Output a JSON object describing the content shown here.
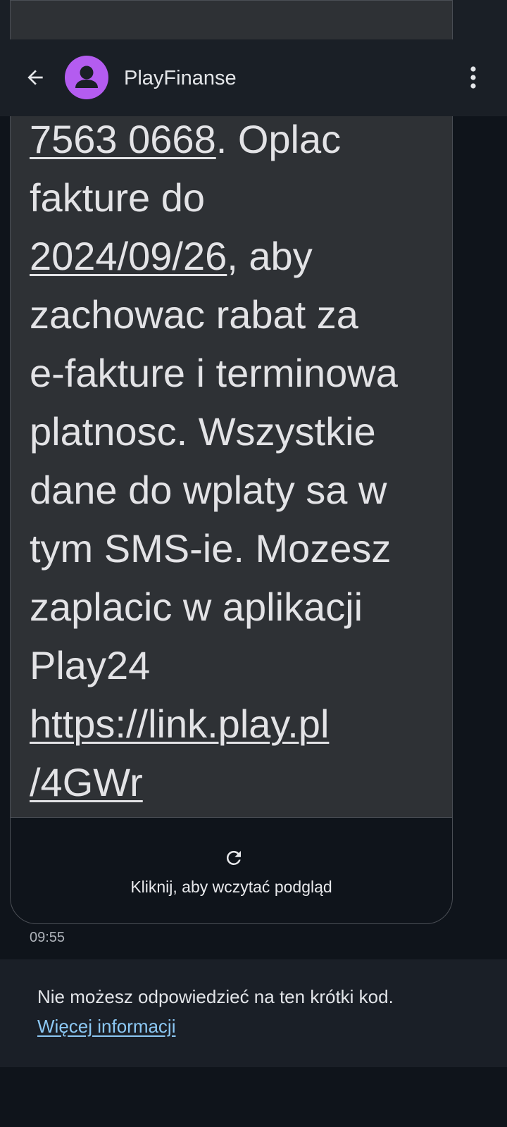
{
  "header": {
    "contact_name": "PlayFinanse",
    "back_icon": "arrow-left-icon",
    "avatar_icon": "person-icon",
    "menu_icon": "more-vert-icon"
  },
  "message": {
    "line_1_link": "7563 0668",
    "line_1_rest": ". Oplac",
    "line_2": "fakture do",
    "line_3_link": "2024/09/26",
    "line_3_rest": ", aby",
    "line_4": "zachowac rabat za",
    "line_5": "e-fakture i terminowa",
    "line_6": "platnosc. Wszystkie",
    "line_7": "dane do wplaty sa w",
    "line_8": "tym SMS-ie. Mozesz",
    "line_9": "zaplacic w aplikacji",
    "line_10": "Play24",
    "url_part_1": "https://link.play.pl",
    "url_part_2": "/4GWr",
    "time": "09:55"
  },
  "link_preview": {
    "icon": "refresh-icon",
    "label": "Kliknij, aby wczytać podgląd"
  },
  "notice": {
    "text": "Nie możesz odpowiedzieć na ten krótki kod.",
    "link_label": "Więcej informacji",
    "link_color": "#8cc8f4"
  },
  "colors": {
    "avatar": "#b45cf0",
    "bubble": "#2e3135",
    "background": "#0f141b"
  }
}
